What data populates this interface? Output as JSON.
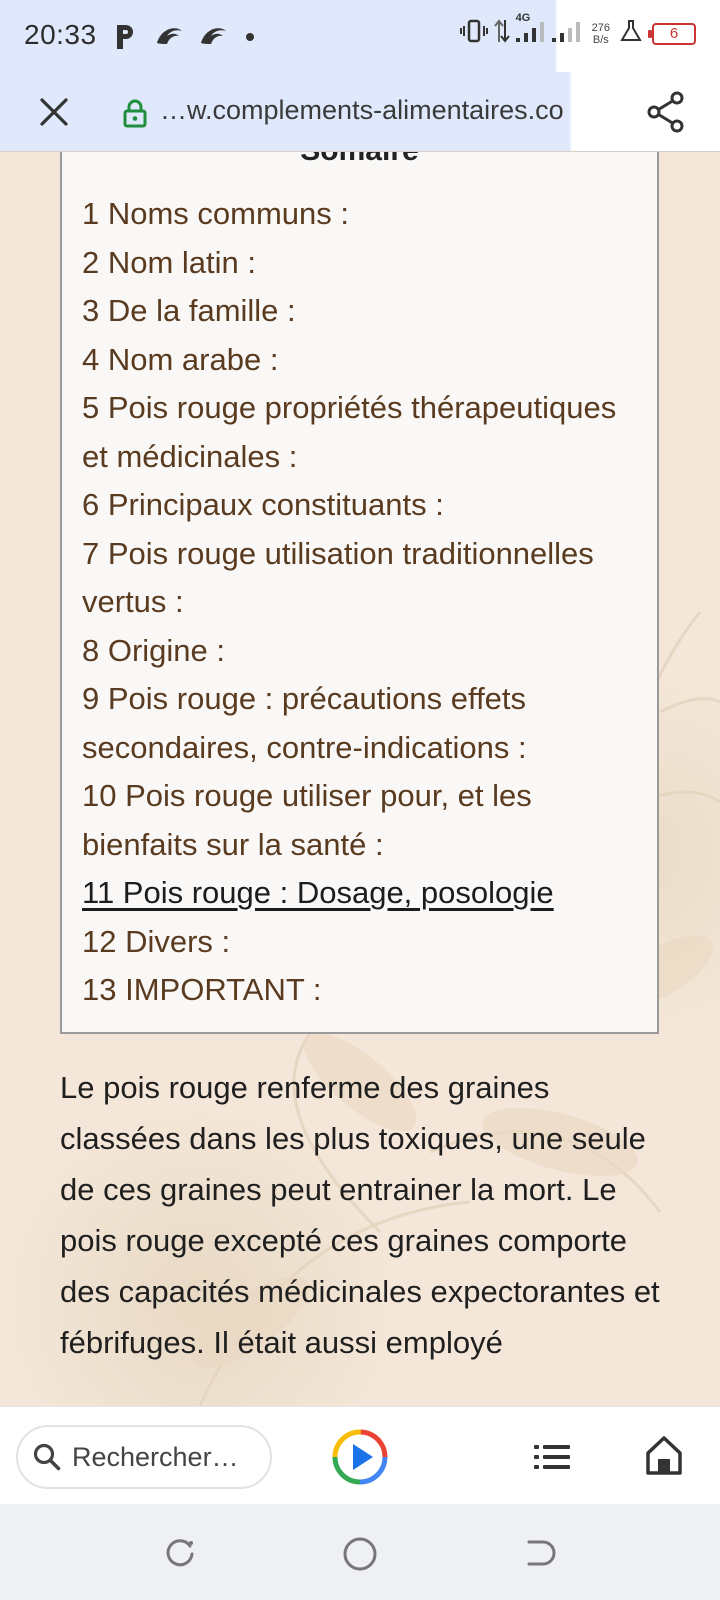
{
  "status_bar": {
    "time": "20:33",
    "left_icons": [
      "parking-icon",
      "app-notification-icon",
      "app-notification-icon"
    ],
    "network_label": "4G",
    "net_speed_value": "276",
    "net_speed_unit": "B/s",
    "battery_level": "6"
  },
  "url_bar": {
    "url": "…w.complements-alimentaires.co",
    "secure": true
  },
  "toc": {
    "title": "Somaire",
    "items": [
      "1 Noms communs :",
      "2 Nom latin :",
      "3 De la famille :",
      "4 Nom arabe :",
      "5 Pois rouge propriétés thérapeutiques et médicinales :",
      "6 Principaux constituants :",
      "7 Pois rouge utilisation traditionnelles vertus :",
      "8 Origine :",
      "9 Pois rouge : précautions effets secondaires, contre-indications :",
      "10 Pois rouge utiliser pour, et les bienfaits sur la santé :",
      "11 Pois rouge : Dosage, posologie",
      "12 Divers :",
      "13 IMPORTANT :"
    ],
    "active_index": 10
  },
  "article": {
    "paragraph": "Le pois rouge renferme des graines classées dans les plus toxiques, une seule de ces graines peut entrainer la mort. Le pois rouge excepté ces graines comporte des capacités médicinales expectorantes et fébrifuges. Il était aussi employé"
  },
  "bottom_bar": {
    "search_placeholder": "Rechercher…"
  },
  "colors": {
    "toc_link": "#5a3b1f",
    "accent_green": "#1e8e3e",
    "battery_red": "#cc3333"
  }
}
